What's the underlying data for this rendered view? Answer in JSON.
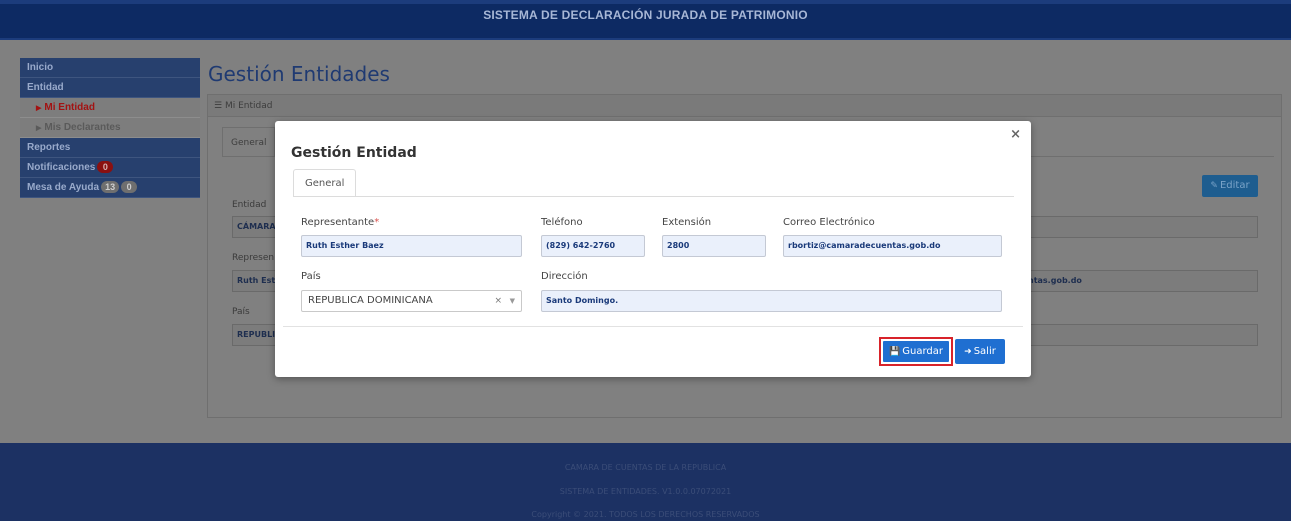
{
  "header": {
    "title": "SISTEMA DE DECLARACIÓN JURADA DE PATRIMONIO"
  },
  "sidebar": {
    "items": [
      {
        "label": "Inicio"
      },
      {
        "label": "Entidad"
      },
      {
        "label": "Mi Entidad"
      },
      {
        "label": "Mis Declarantes"
      },
      {
        "label": "Reportes"
      },
      {
        "label": "Notificaciones",
        "badge": "0"
      },
      {
        "label": "Mesa de Ayuda",
        "badge1": "13",
        "badge2": "0"
      }
    ]
  },
  "page": {
    "title": "Gestión Entidades",
    "breadcrumb": "Mi Entidad",
    "tab": "General",
    "edit_label": "Editar",
    "bg_labels": {
      "entidad": "Entidad",
      "representante": "Represen",
      "pais": "País"
    },
    "bg_values": {
      "entidad": "CÁMARA",
      "representante": "Ruth Esth",
      "email_tail": "ntas.gob.do",
      "pais": "REPUBLIC"
    }
  },
  "modal": {
    "title": "Gestión Entidad",
    "close": "×",
    "tab": "General",
    "fields": {
      "representante_label": "Representante",
      "representante_required": "*",
      "representante": "Ruth Esther Baez",
      "telefono_label": "Teléfono",
      "telefono": "(829) 642-2760",
      "extension_label": "Extensión",
      "extension": "2800",
      "correo_label": "Correo Electrónico",
      "correo": "rbortiz@camaradecuentas.gob.do",
      "pais_label": "País",
      "pais": "REPUBLICA DOMINICANA",
      "direccion_label": "Dirección",
      "direccion": "Santo Domingo."
    },
    "buttons": {
      "guardar": "Guardar",
      "salir": "Salir"
    }
  },
  "footer": {
    "line1": "CAMARA DE CUENTAS DE LA REPUBLICA",
    "line2": "SISTEMA DE ENTIDADES. V1.0.0.07072021",
    "line3": "Copyright © 2021. TODOS LOS DERECHOS RESERVADOS"
  }
}
